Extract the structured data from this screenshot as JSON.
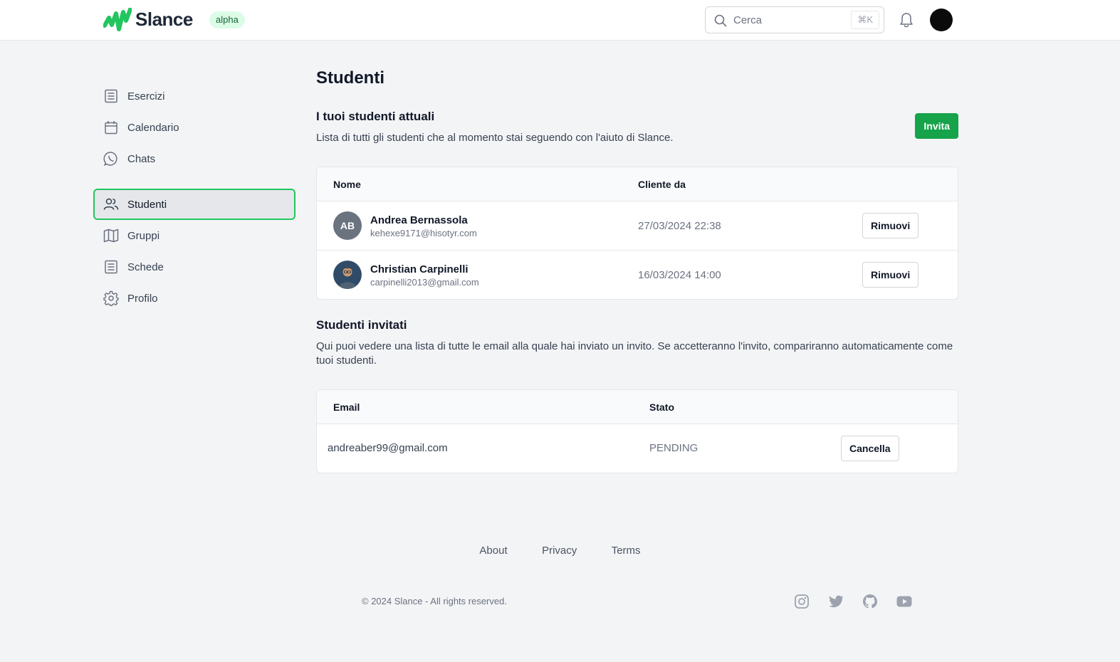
{
  "header": {
    "logo_text": "Slance",
    "badge": "alpha",
    "search": {
      "placeholder": "Cerca",
      "shortcut": "⌘K"
    },
    "notifications_icon": "bell-icon",
    "avatar_color": "#0b0b0b"
  },
  "sidebar": {
    "items": [
      {
        "label": "Esercizi",
        "icon": "document-icon"
      },
      {
        "label": "Calendario",
        "icon": "calendar-icon"
      },
      {
        "label": "Chats",
        "icon": "whatsapp-icon"
      },
      {
        "label": "Studenti",
        "icon": "users-icon",
        "active": true
      },
      {
        "label": "Gruppi",
        "icon": "map-icon"
      },
      {
        "label": "Schede",
        "icon": "document-icon"
      },
      {
        "label": "Profilo",
        "icon": "gear-icon"
      }
    ]
  },
  "main": {
    "title": "Studenti",
    "current": {
      "title": "I tuoi studenti attuali",
      "description": "Lista di tutti gli studenti che al momento stai seguendo con l'aiuto di Slance.",
      "invite_label": "Invita",
      "columns": [
        "Nome",
        "Cliente da"
      ],
      "students": [
        {
          "initials": "AB",
          "name": "Andrea Bernassola",
          "email": "kehexe9171@hisotyr.com",
          "since": "27/03/2024 22:38",
          "action": "Rimuovi"
        },
        {
          "initials": "",
          "name": "Christian Carpinelli",
          "email": "carpinelli2013@gmail.com",
          "since": "16/03/2024 14:00",
          "action": "Rimuovi"
        }
      ]
    },
    "invited": {
      "title": "Studenti invitati",
      "description": "Qui puoi vedere una lista di tutte le email alla quale hai inviato un invito. Se accetteranno l'invito, compariranno automaticamente come tuoi studenti.",
      "columns": [
        "Email",
        "Stato"
      ],
      "rows": [
        {
          "email": "andreaber99@gmail.com",
          "status": "PENDING",
          "action": "Cancella"
        }
      ]
    }
  },
  "footer": {
    "links": [
      "About",
      "Privacy",
      "Terms"
    ],
    "copyright": "© 2024 Slance - All rights reserved.",
    "socials": [
      "instagram-icon",
      "twitter-icon",
      "github-icon",
      "youtube-icon"
    ]
  },
  "colors": {
    "accent": "#16a34a",
    "active_border": "#22c55e",
    "badge_bg": "#dcfce7"
  }
}
